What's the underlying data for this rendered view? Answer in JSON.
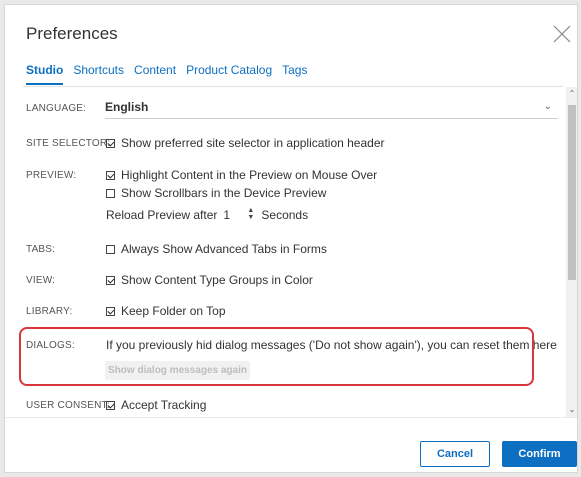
{
  "dialog": {
    "title": "Preferences",
    "close_icon": "close-icon"
  },
  "tabs": [
    {
      "label": "Studio",
      "active": true
    },
    {
      "label": "Shortcuts",
      "active": false
    },
    {
      "label": "Content",
      "active": false
    },
    {
      "label": "Product Catalog",
      "active": false
    },
    {
      "label": "Tags",
      "active": false
    }
  ],
  "language": {
    "label": "LANGUAGE:",
    "value": "English"
  },
  "site_selector": {
    "label": "SITE SELECTOR:",
    "option": "Show preferred site selector in application header",
    "checked": true
  },
  "preview": {
    "label": "PREVIEW:",
    "options": [
      {
        "text": "Highlight Content in the Preview on Mouse Over",
        "checked": true
      },
      {
        "text": "Show Scrollbars in the Device Preview",
        "checked": false
      }
    ],
    "reload_prefix": "Reload Preview after",
    "reload_value": "1",
    "reload_suffix": "Seconds"
  },
  "tabs_pref": {
    "label": "TABS:",
    "option": "Always Show Advanced Tabs in Forms",
    "checked": false
  },
  "view": {
    "label": "VIEW:",
    "option": "Show Content Type Groups in Color",
    "checked": true
  },
  "library": {
    "label": "LIBRARY:",
    "option": "Keep Folder on Top",
    "checked": true
  },
  "dialogs": {
    "label": "DIALOGS:",
    "text": "If you previously hid dialog messages ('Do not show again'), you can reset them here",
    "button": "Show dialog messages again"
  },
  "user_consent": {
    "label": "USER CONSENT:",
    "option": "Accept Tracking",
    "checked": true
  },
  "footer": {
    "cancel": "Cancel",
    "confirm": "Confirm"
  },
  "colors": {
    "accent": "#0d6fc2",
    "highlight": "#d9363e"
  }
}
